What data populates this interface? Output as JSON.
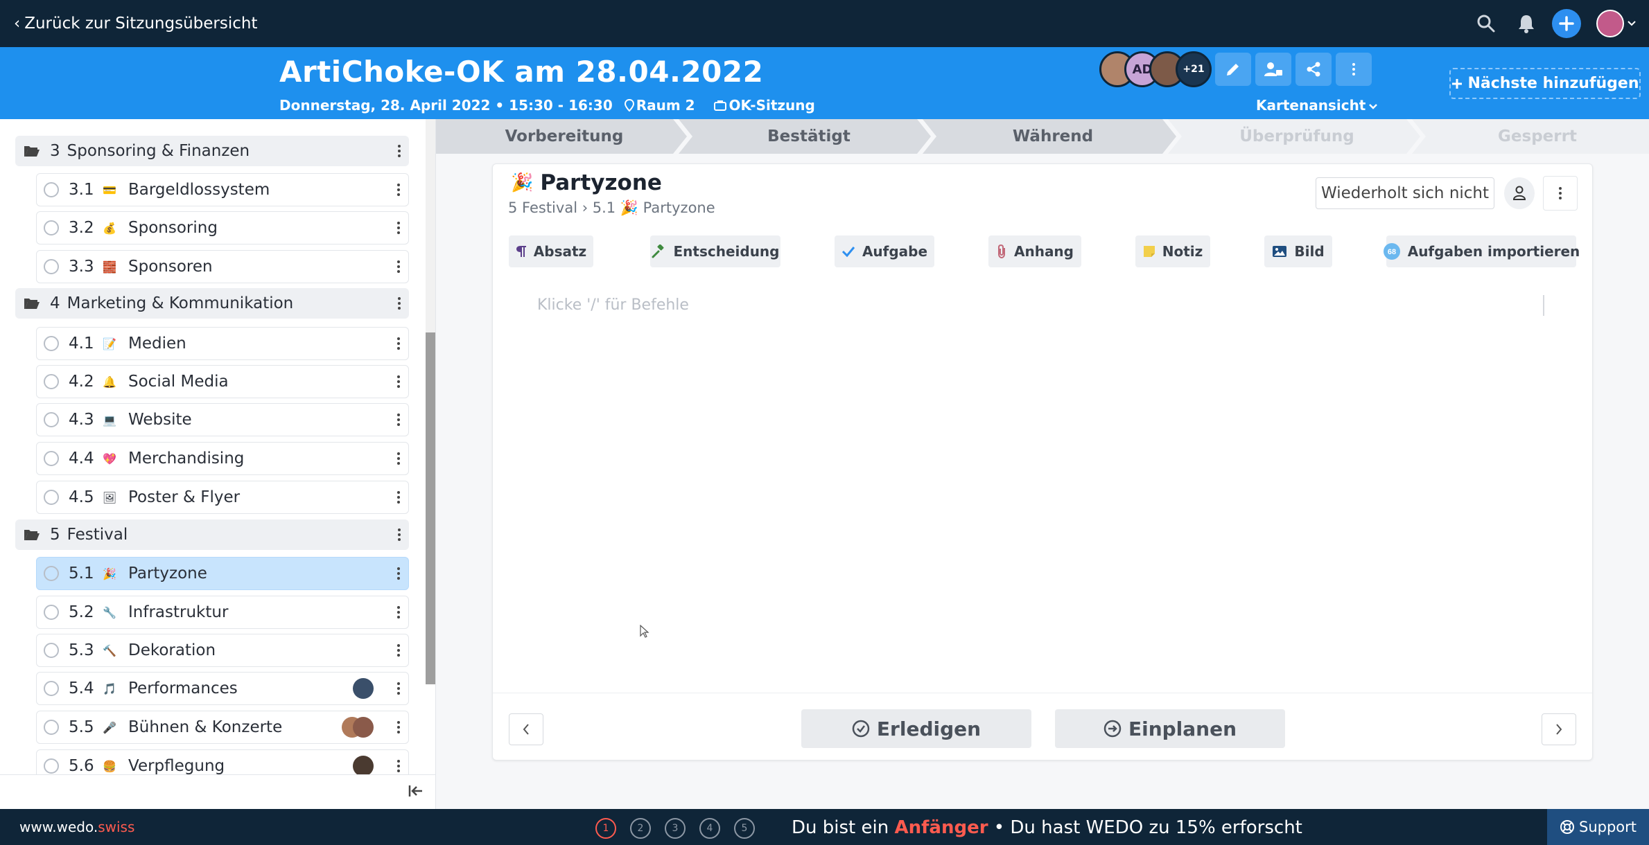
{
  "topbar": {
    "back_label": "Zurück zur Sitzungsübersicht",
    "icons": [
      "search-icon",
      "bell-icon",
      "plus-icon",
      "user-avatar"
    ]
  },
  "header": {
    "title": "ArtiChoke-OK am 28.04.2022",
    "date": "Donnerstag, 28. April 2022 • 15:30 - 16:30",
    "room": "Raum 2",
    "meeting_type": "OK-Sitzung",
    "participants": [
      {
        "initials": "",
        "color": "#b0846a"
      },
      {
        "initials": "AD",
        "color": "#c7a4d6"
      },
      {
        "initials": "",
        "color": "#7d5a48"
      },
      {
        "initials": "+21",
        "color": "#1a3550"
      }
    ],
    "view_label": "Kartenansicht",
    "add_next_label": "Nächste hinzufügen"
  },
  "sidebar": {
    "sections": [
      {
        "num": "3",
        "label": "Sponsoring & Finanzen"
      },
      {
        "num": "4",
        "label": "Marketing & Kommunikation"
      },
      {
        "num": "5",
        "label": "Festival"
      }
    ],
    "items": [
      {
        "num": "3.1",
        "emoji": "💳",
        "label": "Bargeldlossystem"
      },
      {
        "num": "3.2",
        "emoji": "💰",
        "label": "Sponsoring"
      },
      {
        "num": "3.3",
        "emoji": "🧱",
        "label": "Sponsoren"
      },
      {
        "num": "4.1",
        "emoji": "📝",
        "label": "Medien"
      },
      {
        "num": "4.2",
        "emoji": "🔔",
        "label": "Social Media"
      },
      {
        "num": "4.3",
        "emoji": "💻",
        "label": "Website"
      },
      {
        "num": "4.4",
        "emoji": "💖",
        "label": "Merchandising"
      },
      {
        "num": "4.5",
        "emoji": "🖼",
        "label": "Poster & Flyer"
      },
      {
        "num": "5.1",
        "emoji": "🎉",
        "label": "Partyzone"
      },
      {
        "num": "5.2",
        "emoji": "🔧",
        "label": "Infrastruktur"
      },
      {
        "num": "5.3",
        "emoji": "🔨",
        "label": "Dekoration"
      },
      {
        "num": "5.4",
        "emoji": "🎵",
        "label": "Performances"
      },
      {
        "num": "5.5",
        "emoji": "🎤",
        "label": "Bühnen & Konzerte"
      },
      {
        "num": "5.6",
        "emoji": "🍔",
        "label": "Verpflegung"
      }
    ]
  },
  "steps": [
    "Vorbereitung",
    "Bestätigt",
    "Während",
    "Überprüfung",
    "Gesperrt"
  ],
  "card": {
    "emoji": "🎉",
    "title": "Partyzone",
    "breadcrumb": "5 Festival › 5.1 🎉 Partyzone",
    "repeat_label": "Wiederholt sich nicht",
    "tools": [
      "Absatz",
      "Entscheidung",
      "Aufgabe",
      "Anhang",
      "Notiz",
      "Bild",
      "Aufgaben importieren"
    ],
    "placeholder": "Klicke '/' für Befehle",
    "complete_label": "Erledigen",
    "schedule_label": "Einplanen"
  },
  "footer": {
    "brand_main": "www.wedo.",
    "brand_accent": "swiss",
    "progress_steps": [
      "1",
      "2",
      "3",
      "4",
      "5"
    ],
    "progress_prefix": "Du bist ein ",
    "progress_level": "Anfänger",
    "progress_suffix": " • Du hast WEDO zu 15% erforscht",
    "support_label": "Support"
  },
  "colors": {
    "topbar": "#0f2538",
    "header": "#1e90ee",
    "selected_item": "#c8e4fd",
    "accent_red": "#ff5b4f"
  }
}
